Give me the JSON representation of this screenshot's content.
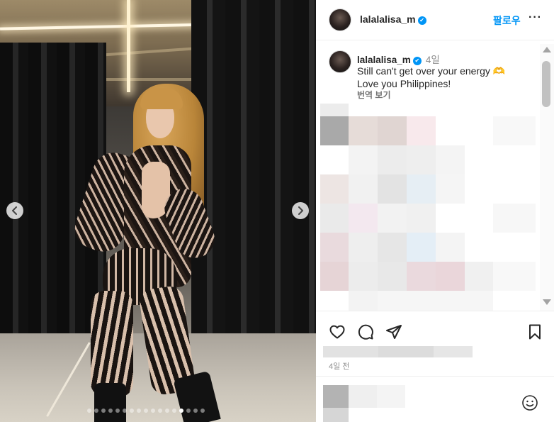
{
  "media": {
    "carousel_dots": 17,
    "active_dot": 13
  },
  "header": {
    "username": "lalalalisa_m",
    "follow_label": "팔로우",
    "more_label": "···"
  },
  "caption": {
    "username": "lalalalisa_m",
    "time": "4일",
    "line1": "Still can't get over your energy",
    "line1_emoji": "🫶",
    "line2": "Love you Philippines!",
    "translate_label": "번역 보기"
  },
  "footer": {
    "date": "4일 전"
  },
  "icons": {
    "verified": "verified-badge-icon",
    "like": "heart-icon",
    "comment": "comment-icon",
    "share": "paper-plane-icon",
    "save": "bookmark-icon",
    "emoji": "smiley-icon",
    "prev": "chevron-left-icon",
    "next": "chevron-right-icon"
  },
  "colors": {
    "accent": "#0095f6",
    "text": "#262626",
    "muted": "#8e8e8e"
  }
}
